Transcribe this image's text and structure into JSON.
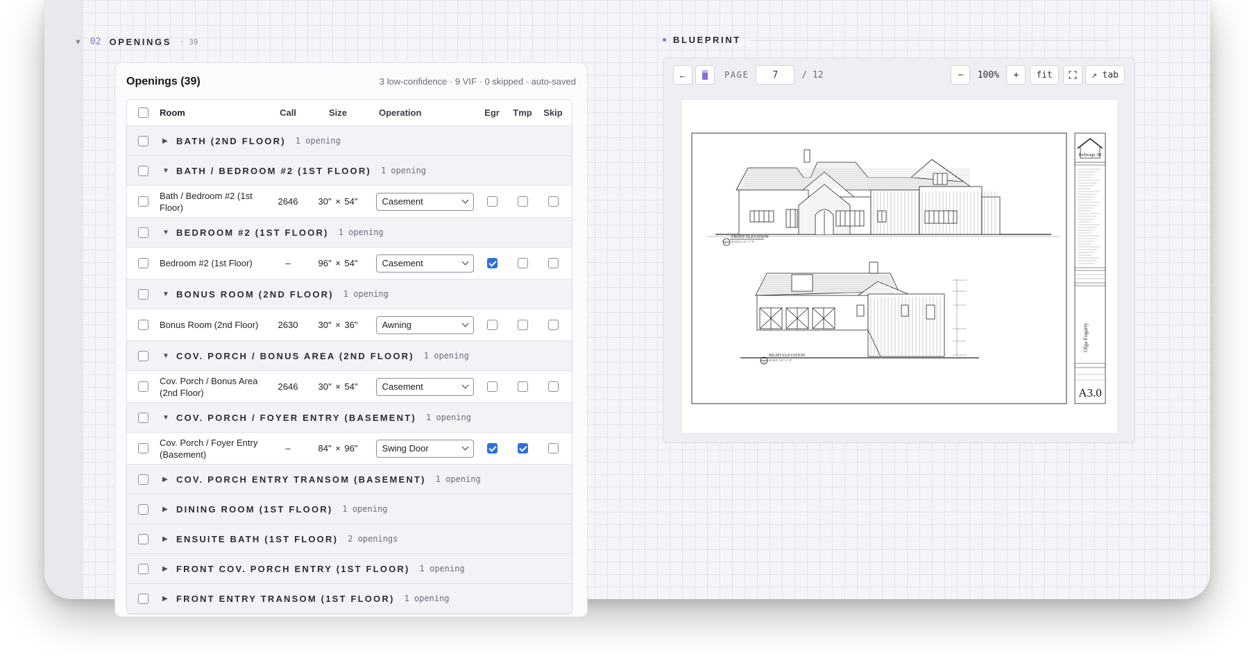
{
  "openings_section": {
    "index": "02",
    "title": "OPENINGS",
    "count": "· 39"
  },
  "panel": {
    "title": "Openings (39)",
    "stats": "3 low-confidence · 9 VIF · 0 skipped · auto-saved"
  },
  "table": {
    "headers": {
      "room": "Room",
      "call": "Call",
      "size": "Size",
      "operation": "Operation",
      "egr": "Egr",
      "tmp": "Tmp",
      "skip": "Skip"
    },
    "rows": [
      {
        "kind": "group",
        "expanded": false,
        "name": "BATH (2ND FLOOR)",
        "count": "1 opening"
      },
      {
        "kind": "group",
        "expanded": true,
        "name": "BATH / BEDROOM #2 (1ST FLOOR)",
        "count": "1 opening"
      },
      {
        "kind": "item",
        "room": "Bath / Bedroom #2 (1st Floor)",
        "call": "2646",
        "size": "30\" × 54\"",
        "operation": "Casement",
        "egr": false,
        "tmp": false,
        "skip": false
      },
      {
        "kind": "group",
        "expanded": true,
        "name": "BEDROOM #2 (1ST FLOOR)",
        "count": "1 opening"
      },
      {
        "kind": "item",
        "room": "Bedroom #2 (1st Floor)",
        "call": "–",
        "size": "96\" × 54\"",
        "operation": "Casement",
        "egr": true,
        "tmp": false,
        "skip": false
      },
      {
        "kind": "group",
        "expanded": true,
        "name": "BONUS ROOM (2ND FLOOR)",
        "count": "1 opening"
      },
      {
        "kind": "item",
        "room": "Bonus Room (2nd Floor)",
        "call": "2630",
        "size": "30\" × 36\"",
        "operation": "Awning",
        "egr": false,
        "tmp": false,
        "skip": false
      },
      {
        "kind": "group",
        "expanded": true,
        "name": "COV. PORCH / BONUS AREA (2ND FLOOR)",
        "count": "1 opening"
      },
      {
        "kind": "item",
        "room": "Cov. Porch / Bonus Area (2nd Floor)",
        "call": "2646",
        "size": "30\" × 54\"",
        "operation": "Casement",
        "egr": false,
        "tmp": false,
        "skip": false
      },
      {
        "kind": "group",
        "expanded": true,
        "name": "COV. PORCH / FOYER ENTRY (BASEMENT)",
        "count": "1 opening"
      },
      {
        "kind": "item",
        "room": "Cov. Porch / Foyer Entry (Basement)",
        "call": "–",
        "size": "84\" × 96\"",
        "operation": "Swing Door",
        "egr": true,
        "tmp": true,
        "skip": false
      },
      {
        "kind": "group",
        "expanded": false,
        "name": "COV. PORCH ENTRY TRANSOM (BASEMENT)",
        "count": "1 opening"
      },
      {
        "kind": "group",
        "expanded": false,
        "name": "DINING ROOM (1ST FLOOR)",
        "count": "1 opening"
      },
      {
        "kind": "group",
        "expanded": false,
        "name": "ENSUITE BATH (1ST FLOOR)",
        "count": "2 openings"
      },
      {
        "kind": "group",
        "expanded": false,
        "name": "FRONT COV. PORCH ENTRY (1ST FLOOR)",
        "count": "1 opening"
      },
      {
        "kind": "group",
        "expanded": false,
        "name": "FRONT ENTRY TRANSOM (1ST FLOOR)",
        "count": "1 opening"
      }
    ]
  },
  "blueprint": {
    "title": "BLUEPRINT",
    "toolbar": {
      "prev": "←",
      "page_label": "PAGE",
      "page_value": "7",
      "page_total": "/ 12",
      "zoom_out": "−",
      "zoom": "100%",
      "zoom_in": "+",
      "fit": "fit",
      "open_tab": "↗ tab"
    },
    "sheet": {
      "front_label": "FRONT ELEVATION",
      "right_label": "RIGHT ELEVATION",
      "scale": "SCALE: 1/4\" = 1'-0\"",
      "view_1": "1",
      "view_2": "2",
      "sheet_ref": "A3.1",
      "logo_text": "ReDesign 3D",
      "designer": "Olga Fogarty",
      "sheet_number": "A3.0"
    }
  }
}
